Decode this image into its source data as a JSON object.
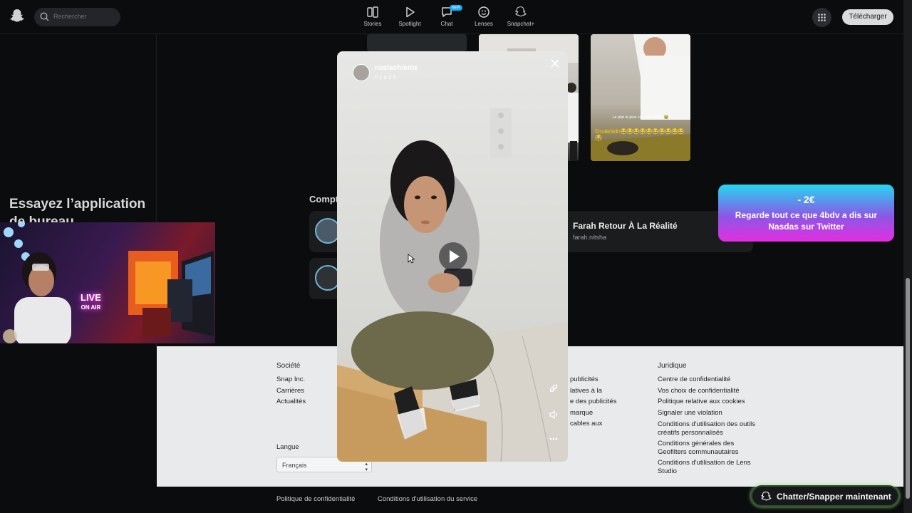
{
  "nav": {
    "search_placeholder": "Rechercher",
    "items": [
      {
        "label": "Stories",
        "icon": "stories-icon"
      },
      {
        "label": "Spotlight",
        "icon": "spotlight-play-icon"
      },
      {
        "label": "Chat",
        "icon": "chat-icon",
        "badge": "NEW"
      },
      {
        "label": "Lenses",
        "icon": "lenses-icon"
      },
      {
        "label": "Snapchat+",
        "icon": "snapchat-plus-ghost-icon"
      }
    ],
    "download_label": "Télécharger"
  },
  "sidebar": {
    "promo_title": "Essayez l’application de bureau"
  },
  "thumbnails": {
    "caption": "Le plat le plus con de France 😭",
    "emojis": "Ecoutez la fin 😂😂😂😂😂😂😂😂😂😂😂"
  },
  "accounts": {
    "section_title": "Compt",
    "farah_name": "Farah Retour À La Réalité",
    "farah_username": "farah.nitsha"
  },
  "modal": {
    "username": "naslachiente",
    "time": "Il y a 3 h"
  },
  "footer": {
    "company_heading": "Société",
    "company_links": [
      "Snap Inc.",
      "Carrières",
      "Actualités"
    ],
    "middle_links": [
      "publicités",
      "latives à la",
      "",
      "e des publicités",
      "",
      "marque",
      "cables aux"
    ],
    "legal_heading": "Juridique",
    "legal_links": [
      "Centre de confidentialité",
      "Vos choix de confidentialité",
      "Politique relative aux cookies",
      "Signaler une violation",
      "Conditions d'utilisation des outils créatifs personnalisés",
      "Conditions générales des Geofilters communautaires",
      "Conditions d'utilisation de Lens Studio"
    ],
    "language_label": "Langue",
    "language_value": "Français",
    "bottom_privacy": "Politique de confidentialité",
    "bottom_terms": "Conditions d'utilisation du service"
  },
  "chat_now_label": "Chatter/Snapper maintenant",
  "promo": {
    "price": "- 2€",
    "message": "Regarde tout ce que 4bdv a dis sur Nasdas sur Twitter"
  },
  "webcam": {
    "sign_line1": "LIVE",
    "sign_line2": "ON AIR"
  }
}
